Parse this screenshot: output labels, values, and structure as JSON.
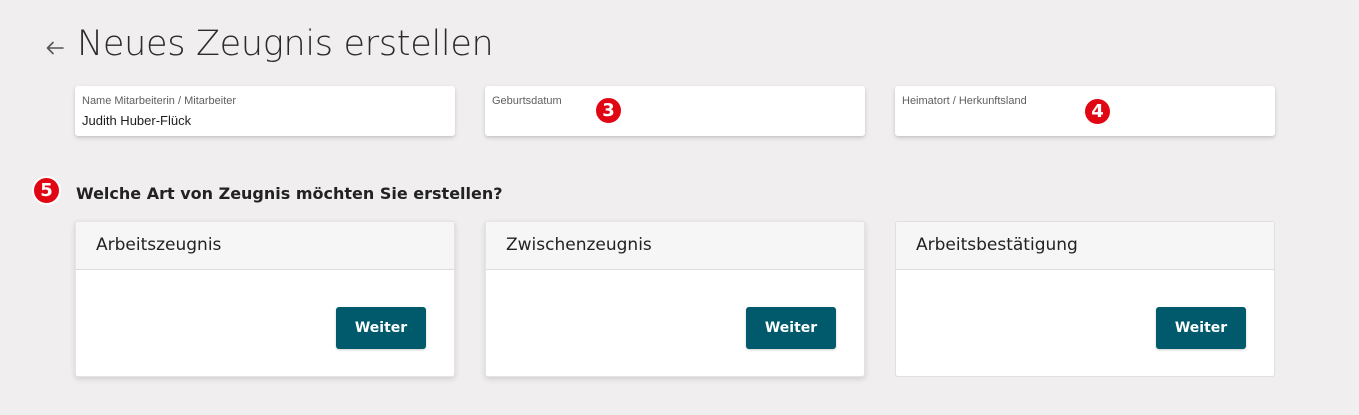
{
  "header": {
    "title": "Neues Zeugnis erstellen",
    "back_icon": "arrow-left-icon"
  },
  "fields": [
    {
      "label": "Name Mitarbeiterin / Mitarbeiter",
      "value": "Judith Huber-Flück"
    },
    {
      "label": "Geburtsdatum",
      "value": ""
    },
    {
      "label": "Heimatort / Herkunftsland",
      "value": ""
    }
  ],
  "markers": {
    "m3": "3",
    "m4": "4",
    "m5": "5",
    "color": "#e10613"
  },
  "question": "Welche Art von Zeugnis möchten Sie erstellen?",
  "cards": [
    {
      "title": "Arbeitszeugnis",
      "button": "Weiter"
    },
    {
      "title": "Zwischenzeugnis",
      "button": "Weiter"
    },
    {
      "title": "Arbeitsbestätigung",
      "button": "Weiter"
    }
  ],
  "colors": {
    "accent": "#005a6b",
    "background": "#f0eeef",
    "marker": "#e10613"
  }
}
